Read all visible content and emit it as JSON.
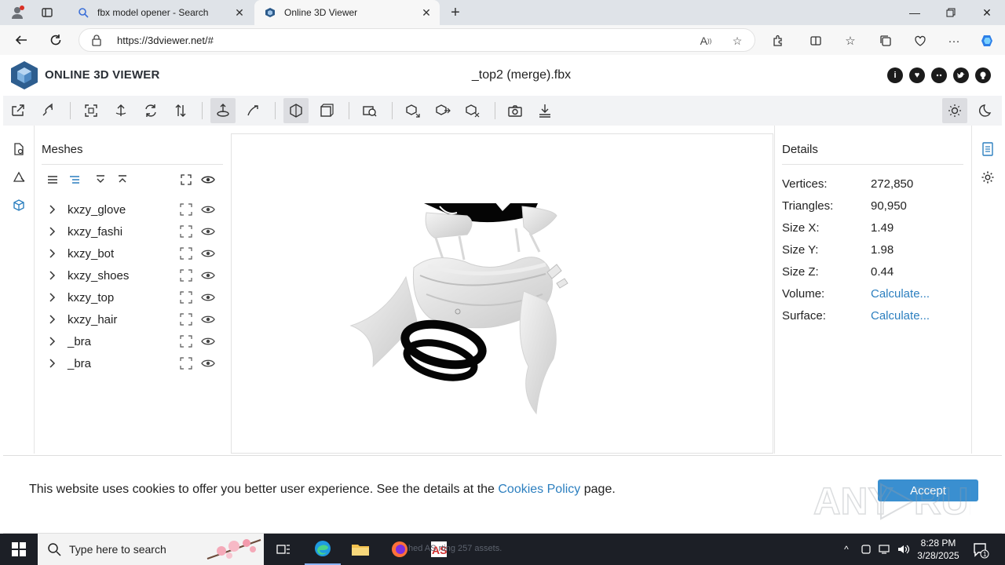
{
  "browser": {
    "tabs": [
      {
        "title": "fbx model opener - Search",
        "active": false
      },
      {
        "title": "Online 3D Viewer",
        "active": true
      }
    ],
    "url": "https://3dviewer.net/#"
  },
  "app": {
    "logo_text": "ONLINE 3D VIEWER",
    "file_title": "_top2 (merge).fbx",
    "social_icons": [
      "info-icon",
      "heart-icon",
      "discord-icon",
      "twitter-icon",
      "github-icon"
    ]
  },
  "meshes": {
    "title": "Meshes",
    "items": [
      {
        "name": "kxzy_glove"
      },
      {
        "name": "kxzy_fashi"
      },
      {
        "name": "kxzy_bot"
      },
      {
        "name": "kxzy_shoes"
      },
      {
        "name": "kxzy_top"
      },
      {
        "name": "kxzy_hair"
      },
      {
        "name": "_bra"
      },
      {
        "name": "_bra"
      }
    ]
  },
  "details": {
    "title": "Details",
    "rows": [
      {
        "key": "Vertices:",
        "value": "272,850"
      },
      {
        "key": "Triangles:",
        "value": "90,950"
      },
      {
        "key": "Size X:",
        "value": "1.49"
      },
      {
        "key": "Size Y:",
        "value": "1.98"
      },
      {
        "key": "Size Z:",
        "value": "0.44"
      },
      {
        "key": "Volume:",
        "value": "Calculate..."
      },
      {
        "key": "Surface:",
        "value": "Calculate..."
      }
    ]
  },
  "cookie": {
    "text_before": "This website uses cookies to offer you better user experience. See the details at the ",
    "link": "Cookies Policy",
    "text_after": " page.",
    "accept": "Accept"
  },
  "taskbar": {
    "search_placeholder": "Type here to search",
    "ghost_text": "hed  AS  rting 257 assets.",
    "time": "8:28 PM",
    "date": "3/28/2025",
    "notification_count": "1"
  },
  "watermark": "ANY RUN",
  "colors": {
    "accent": "#2c7fbf",
    "toolbar_bg": "#f2f3f5",
    "taskbar_bg": "#1c1f26"
  }
}
